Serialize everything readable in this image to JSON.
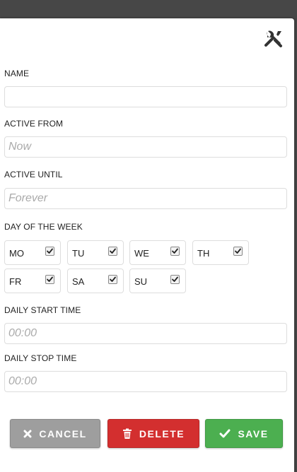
{
  "form": {
    "name_label": "NAME",
    "name_value": "",
    "active_from_label": "ACTIVE FROM",
    "active_from_placeholder": "Now",
    "active_until_label": "ACTIVE UNTIL",
    "active_until_placeholder": "Forever",
    "day_of_week_label": "DAY OF THE WEEK",
    "days": [
      {
        "label": "MO",
        "checked": true
      },
      {
        "label": "TU",
        "checked": true
      },
      {
        "label": "WE",
        "checked": true
      },
      {
        "label": "TH",
        "checked": true
      },
      {
        "label": "FR",
        "checked": true
      },
      {
        "label": "SA",
        "checked": true
      },
      {
        "label": "SU",
        "checked": true
      }
    ],
    "daily_start_label": "DAILY START TIME",
    "daily_start_placeholder": "00:00",
    "daily_stop_label": "DAILY STOP TIME",
    "daily_stop_placeholder": "00:00"
  },
  "buttons": {
    "cancel": "CANCEL",
    "delete": "DELETE",
    "save": "SAVE"
  },
  "icons": {
    "settings": "tools-icon",
    "cancel": "x-icon",
    "delete": "trash-icon",
    "save": "checkmark-icon"
  },
  "colors": {
    "cancel": "#9e9e9e",
    "delete": "#d32f2f",
    "save": "#4caf50"
  }
}
